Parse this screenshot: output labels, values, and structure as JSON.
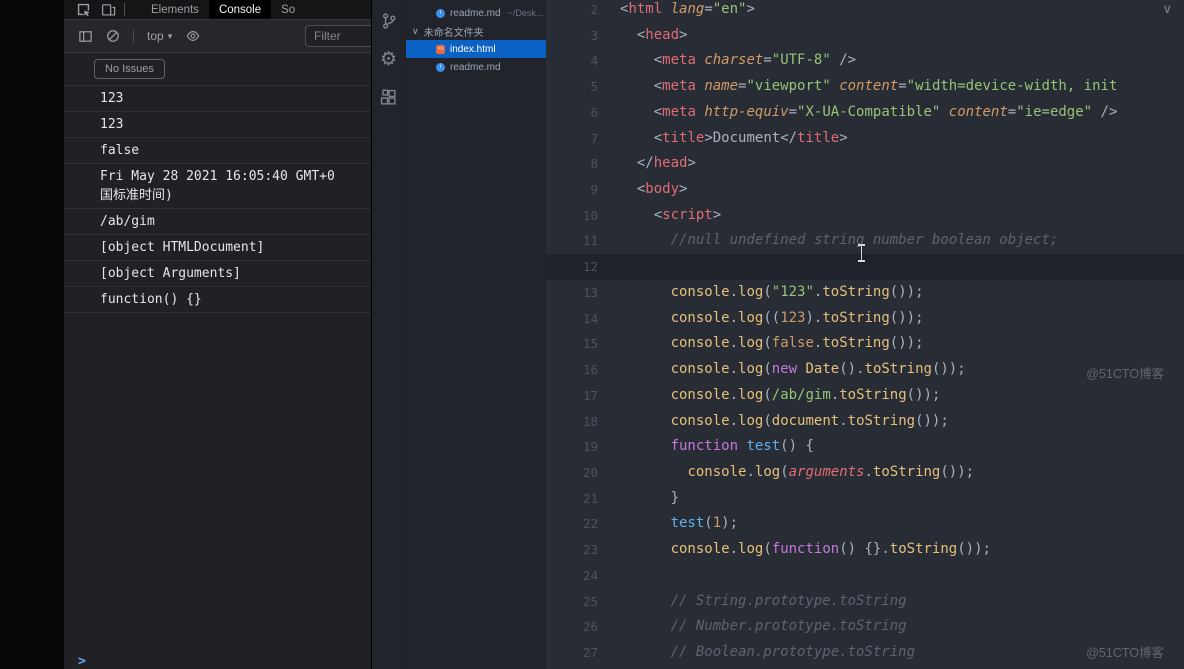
{
  "window": {
    "watermark": "@51CTO博客"
  },
  "devtools": {
    "tabs": [
      {
        "id": "elements",
        "label": "Elements",
        "active": false
      },
      {
        "id": "console",
        "label": "Console",
        "active": true
      },
      {
        "id": "sources",
        "label": "So",
        "active": false
      }
    ],
    "toolbar": {
      "context_selector": "top",
      "caret": "▾",
      "filter_placeholder": "Filter"
    },
    "issues_button": "No Issues",
    "console_entries": [
      {
        "lines": [
          "123"
        ]
      },
      {
        "lines": [
          "123"
        ]
      },
      {
        "lines": [
          "false"
        ]
      },
      {
        "lines": [
          "Fri May 28 2021 16:05:40 GMT+0",
          "国标准时间)"
        ]
      },
      {
        "lines": [
          "/ab/gim"
        ]
      },
      {
        "lines": [
          "[object HTMLDocument]"
        ]
      },
      {
        "lines": [
          "[object Arguments]"
        ]
      },
      {
        "lines": [
          "function() {}"
        ]
      }
    ],
    "prompt_symbol": ">"
  },
  "explorer": {
    "items": [
      {
        "type": "file",
        "icon": "markdown",
        "name": "readme.md",
        "path": "~/Desk...",
        "selected": false,
        "indent": true
      },
      {
        "type": "folder",
        "icon": "chevron-down",
        "name": "未命名文件夹",
        "path": "",
        "selected": false,
        "indent": false
      },
      {
        "type": "file",
        "icon": "html",
        "name": "index.html",
        "path": "",
        "selected": true,
        "indent": true
      },
      {
        "type": "file",
        "icon": "markdown",
        "name": "readme.md",
        "path": "",
        "selected": false,
        "indent": true
      }
    ]
  },
  "editor": {
    "current_line": 12,
    "lines": [
      {
        "n": 2,
        "t": [
          [
            "pun",
            "<"
          ],
          [
            "tag",
            "html"
          ],
          [
            "pun",
            " "
          ],
          [
            "attr",
            "lang"
          ],
          [
            "pun",
            "="
          ],
          [
            "str",
            "\"en\""
          ],
          [
            "pun",
            ">"
          ]
        ]
      },
      {
        "n": 3,
        "t": [
          [
            "pun",
            "  <"
          ],
          [
            "tag",
            "head"
          ],
          [
            "pun",
            ">"
          ]
        ]
      },
      {
        "n": 4,
        "t": [
          [
            "pun",
            "    <"
          ],
          [
            "tag",
            "meta"
          ],
          [
            "pun",
            " "
          ],
          [
            "attr",
            "charset"
          ],
          [
            "pun",
            "="
          ],
          [
            "str",
            "\"UTF-8\""
          ],
          [
            "pun",
            " />"
          ]
        ]
      },
      {
        "n": 5,
        "t": [
          [
            "pun",
            "    <"
          ],
          [
            "tag",
            "meta"
          ],
          [
            "pun",
            " "
          ],
          [
            "attr",
            "name"
          ],
          [
            "pun",
            "="
          ],
          [
            "str",
            "\"viewport\""
          ],
          [
            "pun",
            " "
          ],
          [
            "attr",
            "content"
          ],
          [
            "pun",
            "="
          ],
          [
            "str",
            "\"width=device-width, init"
          ]
        ]
      },
      {
        "n": 6,
        "t": [
          [
            "pun",
            "    <"
          ],
          [
            "tag",
            "meta"
          ],
          [
            "pun",
            " "
          ],
          [
            "attr",
            "http-equiv"
          ],
          [
            "pun",
            "="
          ],
          [
            "str",
            "\"X-UA-Compatible\""
          ],
          [
            "pun",
            " "
          ],
          [
            "attr",
            "content"
          ],
          [
            "pun",
            "="
          ],
          [
            "str",
            "\"ie=edge\""
          ],
          [
            "pun",
            " />"
          ]
        ]
      },
      {
        "n": 7,
        "t": [
          [
            "pun",
            "    <"
          ],
          [
            "tag",
            "title"
          ],
          [
            "pun",
            ">"
          ],
          [
            "txt",
            "Document"
          ],
          [
            "pun",
            "</"
          ],
          [
            "tag",
            "title"
          ],
          [
            "pun",
            ">"
          ]
        ]
      },
      {
        "n": 8,
        "t": [
          [
            "pun",
            "  </"
          ],
          [
            "tag",
            "head"
          ],
          [
            "pun",
            ">"
          ]
        ]
      },
      {
        "n": 9,
        "t": [
          [
            "pun",
            "  <"
          ],
          [
            "tag",
            "body"
          ],
          [
            "pun",
            ">"
          ]
        ]
      },
      {
        "n": 10,
        "t": [
          [
            "pun",
            "    <"
          ],
          [
            "tag",
            "script"
          ],
          [
            "pun",
            ">"
          ]
        ]
      },
      {
        "n": 11,
        "t": [
          [
            "cmt",
            "      //null undefined string number boolean object;"
          ]
        ]
      },
      {
        "n": 12,
        "t": []
      },
      {
        "n": 13,
        "t": [
          [
            "pun",
            "      "
          ],
          [
            "fn",
            "console"
          ],
          [
            "pun",
            "."
          ],
          [
            "fn",
            "log"
          ],
          [
            "pun",
            "("
          ],
          [
            "str",
            "\"123\""
          ],
          [
            "pun",
            "."
          ],
          [
            "fn",
            "toString"
          ],
          [
            "pun",
            "());"
          ]
        ]
      },
      {
        "n": 14,
        "t": [
          [
            "pun",
            "      "
          ],
          [
            "fn",
            "console"
          ],
          [
            "pun",
            "."
          ],
          [
            "fn",
            "log"
          ],
          [
            "pun",
            "(("
          ],
          [
            "num",
            "123"
          ],
          [
            "pun",
            ")."
          ],
          [
            "fn",
            "toString"
          ],
          [
            "pun",
            "());"
          ]
        ]
      },
      {
        "n": 15,
        "t": [
          [
            "pun",
            "      "
          ],
          [
            "fn",
            "console"
          ],
          [
            "pun",
            "."
          ],
          [
            "fn",
            "log"
          ],
          [
            "pun",
            "("
          ],
          [
            "num",
            "false"
          ],
          [
            "pun",
            "."
          ],
          [
            "fn",
            "toString"
          ],
          [
            "pun",
            "());"
          ]
        ]
      },
      {
        "n": 16,
        "t": [
          [
            "pun",
            "      "
          ],
          [
            "fn",
            "console"
          ],
          [
            "pun",
            "."
          ],
          [
            "fn",
            "log"
          ],
          [
            "pun",
            "("
          ],
          [
            "kw",
            "new"
          ],
          [
            "pun",
            " "
          ],
          [
            "fn",
            "Date"
          ],
          [
            "pun",
            "()."
          ],
          [
            "fn",
            "toString"
          ],
          [
            "pun",
            "());"
          ]
        ]
      },
      {
        "n": 17,
        "t": [
          [
            "pun",
            "      "
          ],
          [
            "fn",
            "console"
          ],
          [
            "pun",
            "."
          ],
          [
            "fn",
            "log"
          ],
          [
            "pun",
            "("
          ],
          [
            "rgx",
            "/ab/gim"
          ],
          [
            "pun",
            "."
          ],
          [
            "fn",
            "toString"
          ],
          [
            "pun",
            "());"
          ]
        ]
      },
      {
        "n": 18,
        "t": [
          [
            "pun",
            "      "
          ],
          [
            "fn",
            "console"
          ],
          [
            "pun",
            "."
          ],
          [
            "fn",
            "log"
          ],
          [
            "pun",
            "("
          ],
          [
            "fn",
            "document"
          ],
          [
            "pun",
            "."
          ],
          [
            "fn",
            "toString"
          ],
          [
            "pun",
            "());"
          ]
        ]
      },
      {
        "n": 19,
        "t": [
          [
            "pun",
            "      "
          ],
          [
            "kw",
            "function"
          ],
          [
            "pun",
            " "
          ],
          [
            "mth",
            "test"
          ],
          [
            "pun",
            "() {"
          ]
        ]
      },
      {
        "n": 20,
        "t": [
          [
            "pun",
            "        "
          ],
          [
            "fn",
            "console"
          ],
          [
            "pun",
            "."
          ],
          [
            "fn",
            "log"
          ],
          [
            "pun",
            "("
          ],
          [
            "arg",
            "arguments"
          ],
          [
            "pun",
            "."
          ],
          [
            "fn",
            "toString"
          ],
          [
            "pun",
            "());"
          ]
        ]
      },
      {
        "n": 21,
        "t": [
          [
            "pun",
            "      }"
          ]
        ]
      },
      {
        "n": 22,
        "t": [
          [
            "pun",
            "      "
          ],
          [
            "mth",
            "test"
          ],
          [
            "pun",
            "("
          ],
          [
            "num",
            "1"
          ],
          [
            "pun",
            ");"
          ]
        ]
      },
      {
        "n": 23,
        "t": [
          [
            "pun",
            "      "
          ],
          [
            "fn",
            "console"
          ],
          [
            "pun",
            "."
          ],
          [
            "fn",
            "log"
          ],
          [
            "pun",
            "("
          ],
          [
            "kw",
            "function"
          ],
          [
            "pun",
            "() {}."
          ],
          [
            "fn",
            "toString"
          ],
          [
            "pun",
            "());"
          ]
        ]
      },
      {
        "n": 24,
        "t": []
      },
      {
        "n": 25,
        "t": [
          [
            "cmt",
            "      // String.prototype.toString"
          ]
        ]
      },
      {
        "n": 26,
        "t": [
          [
            "cmt",
            "      // Number.prototype.toString"
          ]
        ]
      },
      {
        "n": 27,
        "t": [
          [
            "cmt",
            "      // Boolean.prototype.toString"
          ]
        ]
      }
    ]
  },
  "icons": {
    "devtools_tabbar": [
      "inspect",
      "device-toolbar"
    ],
    "devtools_toolbar": [
      "console-sidebar",
      "clear-console",
      "eye"
    ],
    "activity_bar": [
      "source-control",
      "settings-gear",
      "extensions"
    ],
    "editor_top_right": [
      "chevron-down"
    ]
  },
  "colors": {
    "accent_selection": "#0b61c4",
    "editor_background": "#282c34",
    "devtools_background": "#202124",
    "tag": "#e06c75",
    "string": "#98c379",
    "keyword": "#c678dd",
    "function": "#e5c07b"
  }
}
